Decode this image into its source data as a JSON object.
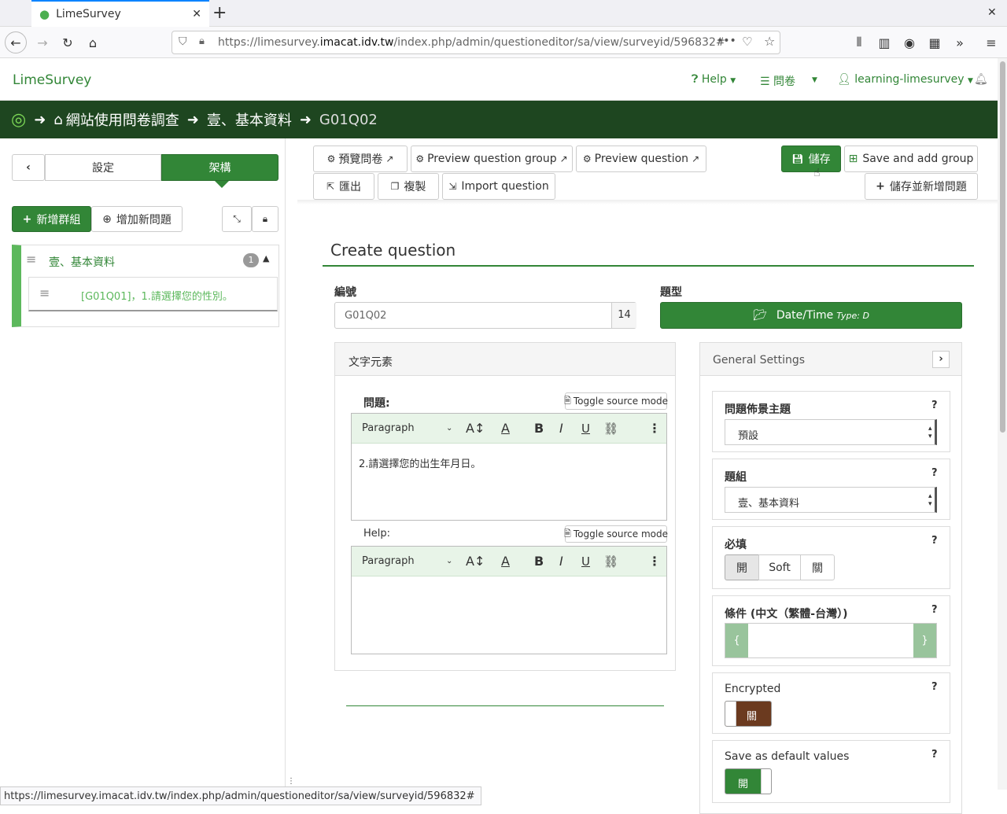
{
  "browser": {
    "tab_title": "LimeSurvey",
    "new_tab": "+",
    "url_host_prefix": "https://limesurvey.",
    "url_host_main": "imacat.idv.tw",
    "url_path": "/index.php/admin/questioneditor/sa/view/surveyid/596832#",
    "status_url": "https://limesurvey.imacat.idv.tw/index.php/admin/questioneditor/sa/view/surveyid/596832#"
  },
  "header": {
    "brand": "LimeSurvey",
    "help": "Help",
    "surveys": "問卷",
    "user": "learning-limesurvey"
  },
  "breadcrumb": {
    "survey": "網站使用問卷調查",
    "group": "壹、基本資料",
    "question": "G01Q02"
  },
  "sidebar": {
    "tab_settings": "設定",
    "tab_structure": "架構",
    "add_group": "新增群組",
    "add_question": "增加新問題",
    "group_name": "壹、基本資料",
    "group_count": "1",
    "question_item": "[G01Q01]，1.請選擇您的性別。"
  },
  "toolbar": {
    "preview_survey": "預覽問卷",
    "preview_group": "Preview question group",
    "preview_question": "Preview question",
    "export": "匯出",
    "copy": "複製",
    "import": "Import question",
    "save": "儲存",
    "save_add_group": "Save and add group",
    "save_add_question": "儲存並新增問題"
  },
  "form": {
    "heading": "Create question",
    "code_label": "編號",
    "code_value": "G01Q02",
    "code_counter": "14",
    "type_label": "題型",
    "type_value": "Date/Time",
    "type_code": "Type: D",
    "text_elements_title": "文字元素",
    "question_label": "問題:",
    "toggle_source": "Toggle source mode",
    "paragraph": "Paragraph",
    "question_text": "2.請選擇您的出生年月日。",
    "help_label": "Help:",
    "help_text": ""
  },
  "general_settings": {
    "title": "General Settings",
    "theme_label": "問題佈景主題",
    "theme_value": "預設",
    "group_label": "題組",
    "group_value": "壹、基本資料",
    "mandatory_label": "必填",
    "mandatory_on": "開",
    "mandatory_soft": "Soft",
    "mandatory_off": "關",
    "condition_label": "條件 (中文（繁體-台灣）)",
    "condition_open": "{",
    "condition_close": "}",
    "encrypted_label": "Encrypted",
    "encrypted_value": "關",
    "save_default_label": "Save as default values",
    "save_default_value": "開",
    "help_mark": "?"
  },
  "colors": {
    "brand_green": "#328637",
    "dark_green": "#1e4620",
    "encrypted_off": "#6b3a1f"
  }
}
